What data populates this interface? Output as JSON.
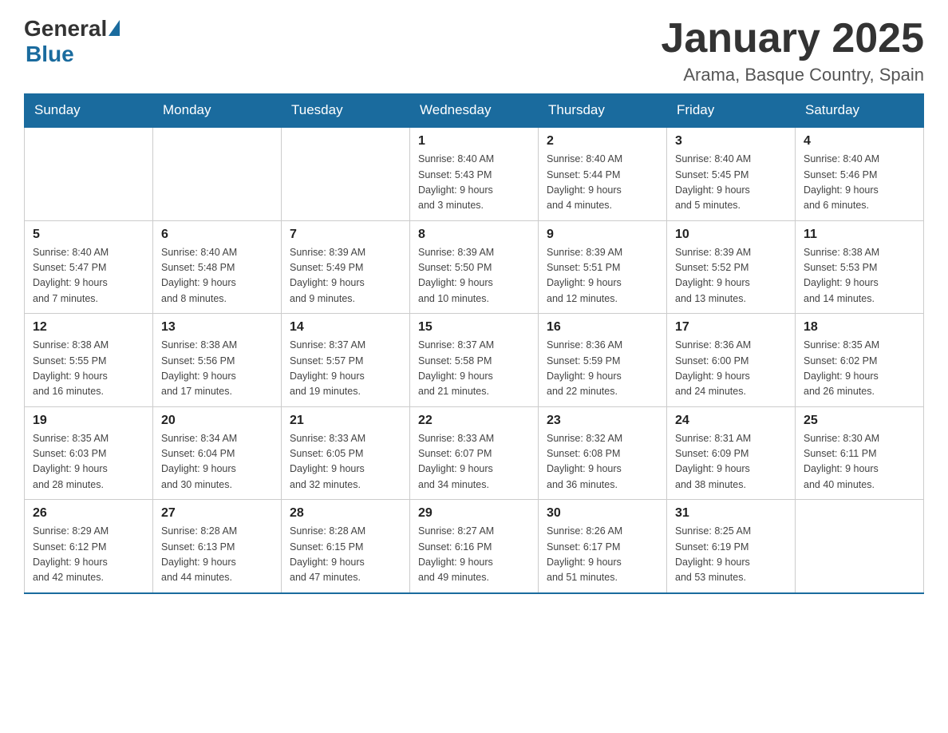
{
  "header": {
    "logo_general": "General",
    "logo_blue": "Blue",
    "month_title": "January 2025",
    "location": "Arama, Basque Country, Spain"
  },
  "days_of_week": [
    "Sunday",
    "Monday",
    "Tuesday",
    "Wednesday",
    "Thursday",
    "Friday",
    "Saturday"
  ],
  "weeks": [
    {
      "cells": [
        {
          "day": "",
          "info": ""
        },
        {
          "day": "",
          "info": ""
        },
        {
          "day": "",
          "info": ""
        },
        {
          "day": "1",
          "info": "Sunrise: 8:40 AM\nSunset: 5:43 PM\nDaylight: 9 hours\nand 3 minutes."
        },
        {
          "day": "2",
          "info": "Sunrise: 8:40 AM\nSunset: 5:44 PM\nDaylight: 9 hours\nand 4 minutes."
        },
        {
          "day": "3",
          "info": "Sunrise: 8:40 AM\nSunset: 5:45 PM\nDaylight: 9 hours\nand 5 minutes."
        },
        {
          "day": "4",
          "info": "Sunrise: 8:40 AM\nSunset: 5:46 PM\nDaylight: 9 hours\nand 6 minutes."
        }
      ]
    },
    {
      "cells": [
        {
          "day": "5",
          "info": "Sunrise: 8:40 AM\nSunset: 5:47 PM\nDaylight: 9 hours\nand 7 minutes."
        },
        {
          "day": "6",
          "info": "Sunrise: 8:40 AM\nSunset: 5:48 PM\nDaylight: 9 hours\nand 8 minutes."
        },
        {
          "day": "7",
          "info": "Sunrise: 8:39 AM\nSunset: 5:49 PM\nDaylight: 9 hours\nand 9 minutes."
        },
        {
          "day": "8",
          "info": "Sunrise: 8:39 AM\nSunset: 5:50 PM\nDaylight: 9 hours\nand 10 minutes."
        },
        {
          "day": "9",
          "info": "Sunrise: 8:39 AM\nSunset: 5:51 PM\nDaylight: 9 hours\nand 12 minutes."
        },
        {
          "day": "10",
          "info": "Sunrise: 8:39 AM\nSunset: 5:52 PM\nDaylight: 9 hours\nand 13 minutes."
        },
        {
          "day": "11",
          "info": "Sunrise: 8:38 AM\nSunset: 5:53 PM\nDaylight: 9 hours\nand 14 minutes."
        }
      ]
    },
    {
      "cells": [
        {
          "day": "12",
          "info": "Sunrise: 8:38 AM\nSunset: 5:55 PM\nDaylight: 9 hours\nand 16 minutes."
        },
        {
          "day": "13",
          "info": "Sunrise: 8:38 AM\nSunset: 5:56 PM\nDaylight: 9 hours\nand 17 minutes."
        },
        {
          "day": "14",
          "info": "Sunrise: 8:37 AM\nSunset: 5:57 PM\nDaylight: 9 hours\nand 19 minutes."
        },
        {
          "day": "15",
          "info": "Sunrise: 8:37 AM\nSunset: 5:58 PM\nDaylight: 9 hours\nand 21 minutes."
        },
        {
          "day": "16",
          "info": "Sunrise: 8:36 AM\nSunset: 5:59 PM\nDaylight: 9 hours\nand 22 minutes."
        },
        {
          "day": "17",
          "info": "Sunrise: 8:36 AM\nSunset: 6:00 PM\nDaylight: 9 hours\nand 24 minutes."
        },
        {
          "day": "18",
          "info": "Sunrise: 8:35 AM\nSunset: 6:02 PM\nDaylight: 9 hours\nand 26 minutes."
        }
      ]
    },
    {
      "cells": [
        {
          "day": "19",
          "info": "Sunrise: 8:35 AM\nSunset: 6:03 PM\nDaylight: 9 hours\nand 28 minutes."
        },
        {
          "day": "20",
          "info": "Sunrise: 8:34 AM\nSunset: 6:04 PM\nDaylight: 9 hours\nand 30 minutes."
        },
        {
          "day": "21",
          "info": "Sunrise: 8:33 AM\nSunset: 6:05 PM\nDaylight: 9 hours\nand 32 minutes."
        },
        {
          "day": "22",
          "info": "Sunrise: 8:33 AM\nSunset: 6:07 PM\nDaylight: 9 hours\nand 34 minutes."
        },
        {
          "day": "23",
          "info": "Sunrise: 8:32 AM\nSunset: 6:08 PM\nDaylight: 9 hours\nand 36 minutes."
        },
        {
          "day": "24",
          "info": "Sunrise: 8:31 AM\nSunset: 6:09 PM\nDaylight: 9 hours\nand 38 minutes."
        },
        {
          "day": "25",
          "info": "Sunrise: 8:30 AM\nSunset: 6:11 PM\nDaylight: 9 hours\nand 40 minutes."
        }
      ]
    },
    {
      "cells": [
        {
          "day": "26",
          "info": "Sunrise: 8:29 AM\nSunset: 6:12 PM\nDaylight: 9 hours\nand 42 minutes."
        },
        {
          "day": "27",
          "info": "Sunrise: 8:28 AM\nSunset: 6:13 PM\nDaylight: 9 hours\nand 44 minutes."
        },
        {
          "day": "28",
          "info": "Sunrise: 8:28 AM\nSunset: 6:15 PM\nDaylight: 9 hours\nand 47 minutes."
        },
        {
          "day": "29",
          "info": "Sunrise: 8:27 AM\nSunset: 6:16 PM\nDaylight: 9 hours\nand 49 minutes."
        },
        {
          "day": "30",
          "info": "Sunrise: 8:26 AM\nSunset: 6:17 PM\nDaylight: 9 hours\nand 51 minutes."
        },
        {
          "day": "31",
          "info": "Sunrise: 8:25 AM\nSunset: 6:19 PM\nDaylight: 9 hours\nand 53 minutes."
        },
        {
          "day": "",
          "info": ""
        }
      ]
    }
  ]
}
